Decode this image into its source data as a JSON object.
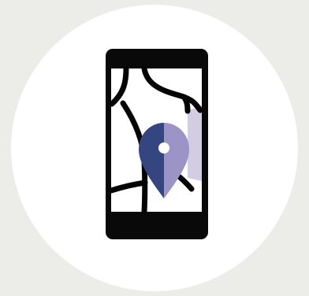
{
  "icon": {
    "name": "mobile-map-location-icon"
  },
  "colors": {
    "background": "#ECECE8",
    "circle": "#FFFFFF",
    "phone_body": "#090909",
    "screen": "#FFFFFF",
    "roads": "#050505",
    "highlight_area": "#D3CCE3",
    "pin_left": "#34457F",
    "pin_right": "#9C93C7",
    "pin_hole": "#FFFFFF"
  }
}
